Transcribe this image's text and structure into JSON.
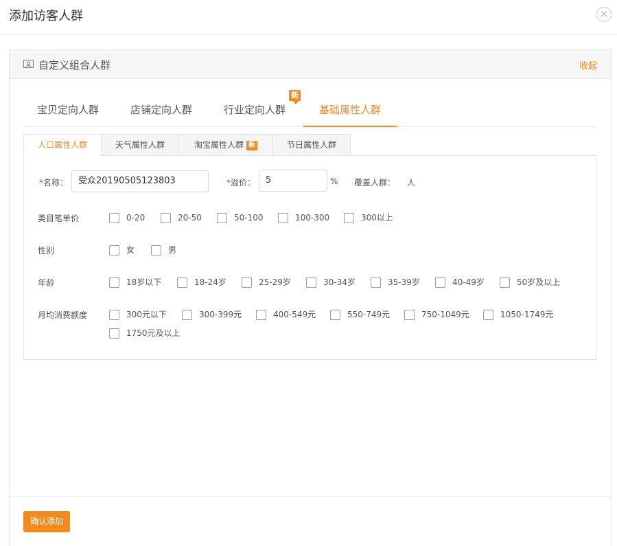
{
  "dialog": {
    "title": "添加访客人群",
    "close_symbol": "×"
  },
  "panel": {
    "icon": "person-card-icon",
    "title": "自定义组合人群",
    "collapse_label": "收起"
  },
  "main_tabs": [
    {
      "label": "宝贝定向人群",
      "active": false
    },
    {
      "label": "店铺定向人群",
      "active": false
    },
    {
      "label": "行业定向人群",
      "active": false,
      "badge": "新"
    },
    {
      "label": "基础属性人群",
      "active": true
    }
  ],
  "sub_tabs": [
    {
      "label": "人口属性人群",
      "active": true
    },
    {
      "label": "天气属性人群",
      "active": false
    },
    {
      "label": "淘宝属性人群",
      "active": false,
      "badge": "新"
    },
    {
      "label": "节日属性人群",
      "active": false
    }
  ],
  "form": {
    "name": {
      "required_mark": "*",
      "label": "名称：",
      "value": "受众20190505123803"
    },
    "premium": {
      "required_mark": "*",
      "label": "溢价：",
      "value": "5",
      "unit": "%"
    },
    "coverage": {
      "label": "覆盖人群：",
      "unit": "人"
    },
    "groups": [
      {
        "label": "类目笔单价",
        "options": [
          "0-20",
          "20-50",
          "50-100",
          "100-300",
          "300以上"
        ]
      },
      {
        "label": "性别",
        "options": [
          "女",
          "男"
        ]
      },
      {
        "label": "年龄",
        "options": [
          "18岁以下",
          "18-24岁",
          "25-29岁",
          "30-34岁",
          "35-39岁",
          "40-49岁",
          "50岁及以上"
        ]
      },
      {
        "label": "月均消费额度",
        "options": [
          "300元以下",
          "300-399元",
          "400-549元",
          "550-749元",
          "750-1049元",
          "1050-1749元",
          "1750元及以上"
        ]
      }
    ]
  },
  "footer": {
    "confirm_label": "确认添加"
  },
  "colors": {
    "accent": "#f28a1e",
    "required": "#e4393c"
  }
}
